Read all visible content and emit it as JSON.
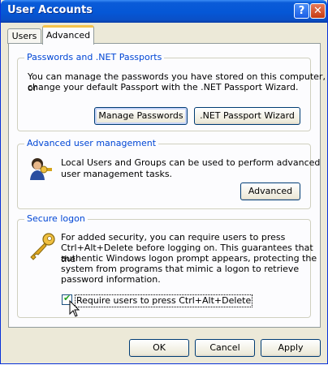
{
  "window": {
    "title": "User Accounts",
    "help_glyph": "?",
    "close_glyph": "✕"
  },
  "tabs": [
    {
      "label": "Users",
      "selected": false
    },
    {
      "label": "Advanced",
      "selected": true
    }
  ],
  "passwords_group": {
    "legend": "Passwords and .NET Passports",
    "text_line1": "You can manage the passwords you have stored on this computer, or",
    "text_line2": "change your default Passport with the .NET Passport Wizard.",
    "manage_passwords_label": "Manage Passwords",
    "passport_wizard_label": ".NET Passport Wizard"
  },
  "advanced_group": {
    "legend": "Advanced user management",
    "text_line1": "Local Users and Groups can be used to perform advanced",
    "text_line2": "user management tasks.",
    "advanced_label": "Advanced",
    "icon": "users-and-keys-icon"
  },
  "secure_logon_group": {
    "legend": "Secure logon",
    "text_line1": "For added security, you can require users to press",
    "text_line2": "Ctrl+Alt+Delete before logging on. This guarantees that the",
    "text_line3": "authentic Windows logon prompt appears, protecting the",
    "text_line4": "system from programs that mimic a logon to retrieve",
    "text_line5": "password information.",
    "checkbox_label": "Require users to press Ctrl+Alt+Delete",
    "checkbox_checked": true,
    "icon": "key-icon"
  },
  "footer": {
    "ok_label": "OK",
    "cancel_label": "Cancel",
    "apply_label": "Apply"
  },
  "colors": {
    "title_bar": "#0a5bd8",
    "legend_text": "#0046d5",
    "tab_highlight": "#f5c24a",
    "dialog_bg": "#ece9d8"
  }
}
